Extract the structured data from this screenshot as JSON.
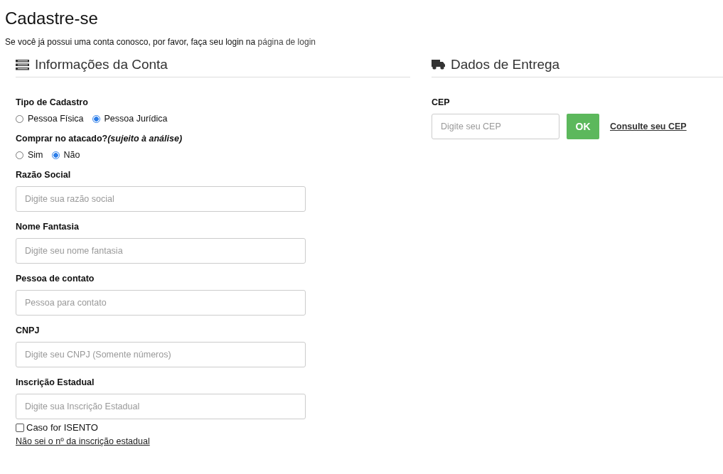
{
  "page": {
    "title": "Cadastre-se",
    "intro": "Se você já possui uma conta conosco, por favor, faça seu login na",
    "login_link": "página de login"
  },
  "account": {
    "heading": "Informações da Conta",
    "fields": [
      {
        "kind": "radio",
        "label": "Tipo de Cadastro",
        "options": [
          {
            "label": "Pessoa Física",
            "selected": false
          },
          {
            "label": "Pessoa Jurídica",
            "selected": true
          }
        ]
      },
      {
        "kind": "radio",
        "label": "Comprar no atacado?*(sujeito à análise)*",
        "options": [
          {
            "label": "Sim",
            "selected": false
          },
          {
            "label": "Não",
            "selected": true
          }
        ]
      },
      {
        "kind": "text",
        "label": "Razão Social",
        "placeholder": "Digite sua razão social"
      },
      {
        "kind": "text",
        "label": "Nome Fantasia",
        "placeholder": "Digite seu nome fantasia"
      },
      {
        "kind": "text",
        "label": "Pessoa de contato",
        "placeholder": "Pessoa para contato"
      },
      {
        "kind": "text",
        "label": "CNPJ",
        "placeholder": "Digite seu CNPJ (Somente números)"
      },
      {
        "kind": "text",
        "label": "Inscrição Estadual",
        "placeholder": "Digite sua Inscrição Estadual"
      }
    ],
    "exempt": {
      "label": "Caso for ISENTO",
      "checked": false
    },
    "help_link": "Não sei o nº da inscrição estadual"
  },
  "delivery": {
    "heading": "Dados de Entrega",
    "cep_label": "CEP",
    "cep_placeholder": "Digite seu CEP",
    "ok_button": "OK",
    "lookup_link": "Consulte seu CEP"
  }
}
